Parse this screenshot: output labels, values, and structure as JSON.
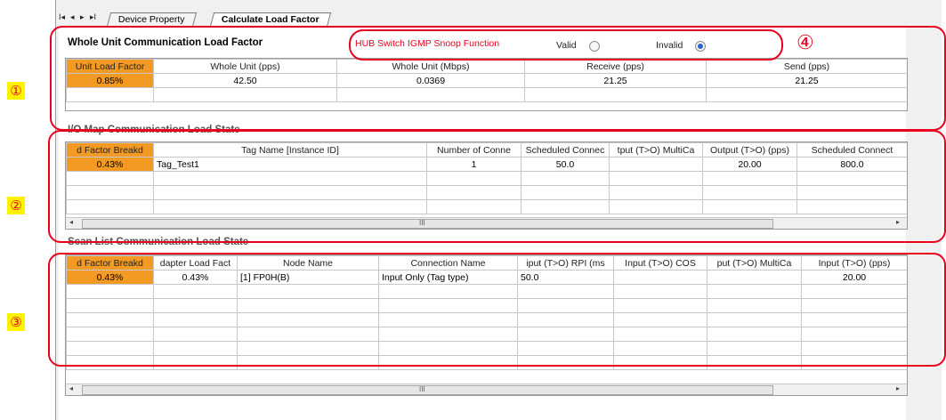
{
  "tabs": {
    "nav": [
      "I◂",
      "◂",
      "▸",
      "▸I"
    ],
    "device_property": "Device Property",
    "calculate_load_factor": "Calculate Load Factor"
  },
  "section1": {
    "title": "Whole Unit Communication Load Factor",
    "hub_label": "HUB Switch IGMP Snoop Function",
    "valid_label": "Valid",
    "invalid_label": "Invalid",
    "selected": "Invalid",
    "headers": [
      "Unit Load Factor",
      "Whole Unit (pps)",
      "Whole Unit (Mbps)",
      "Receive (pps)",
      "Send (pps)"
    ],
    "row": [
      "0.85%",
      "42.50",
      "0.0369",
      "21.25",
      "21.25"
    ]
  },
  "section2": {
    "title": "I/O Map Communication Load State",
    "headers": [
      "d Factor Breakd",
      "Tag Name [Instance ID]",
      "Number of Conne",
      "Scheduled Connec",
      "tput (T>O) MultiCa",
      "Output (T>O) (pps)",
      "Scheduled Connect"
    ],
    "row": [
      "0.43%",
      "Tag_Test1",
      "1",
      "50.0",
      "",
      "20.00",
      "800.0"
    ]
  },
  "section3": {
    "title": "Scan List Communication Load State",
    "headers": [
      "d Factor Breakd",
      "dapter Load Fact",
      "Node Name",
      "Connection Name",
      "iput (T>O) RPI (ms",
      "Input (T>O) COS",
      "put (T>O) MultiCa",
      "Input (T>O) (pps)"
    ],
    "row": [
      "0.43%",
      "0.43%",
      "[1] FP0H(B)",
      "Input Only (Tag type)",
      "50.0",
      "",
      "",
      "20.00"
    ]
  },
  "scroll_grip": "III",
  "annotations": {
    "m1": "①",
    "m2": "②",
    "m3": "③",
    "m4": "④",
    "callout_color": "#e8001c",
    "marker_bg": "#fff200",
    "highlight_color": "#f29a24"
  }
}
